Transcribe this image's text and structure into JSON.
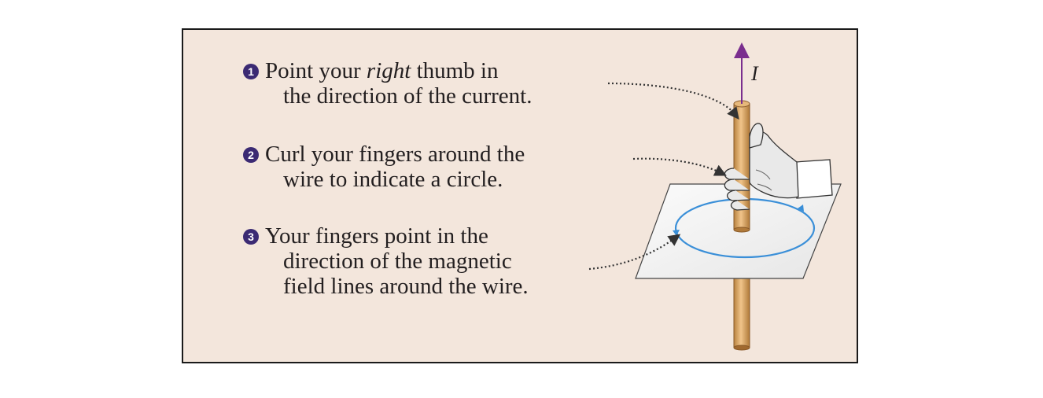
{
  "steps": [
    {
      "number": "1",
      "lines": [
        "Point your ",
        "right",
        " thumb in",
        "the direction of the current."
      ]
    },
    {
      "number": "2",
      "lines": [
        "Curl your fingers around the",
        "wire to indicate a circle."
      ]
    },
    {
      "number": "3",
      "lines": [
        "Your fingers point in the",
        "direction of the magnetic",
        "field lines around the wire."
      ]
    }
  ],
  "current_symbol": "I",
  "colors": {
    "panel_background": "#f3e6dc",
    "badge": "#3b2a73",
    "current_arrow": "#7a2e8e",
    "field_lines": "#3a8fd8",
    "wire": "#d9a86c"
  }
}
